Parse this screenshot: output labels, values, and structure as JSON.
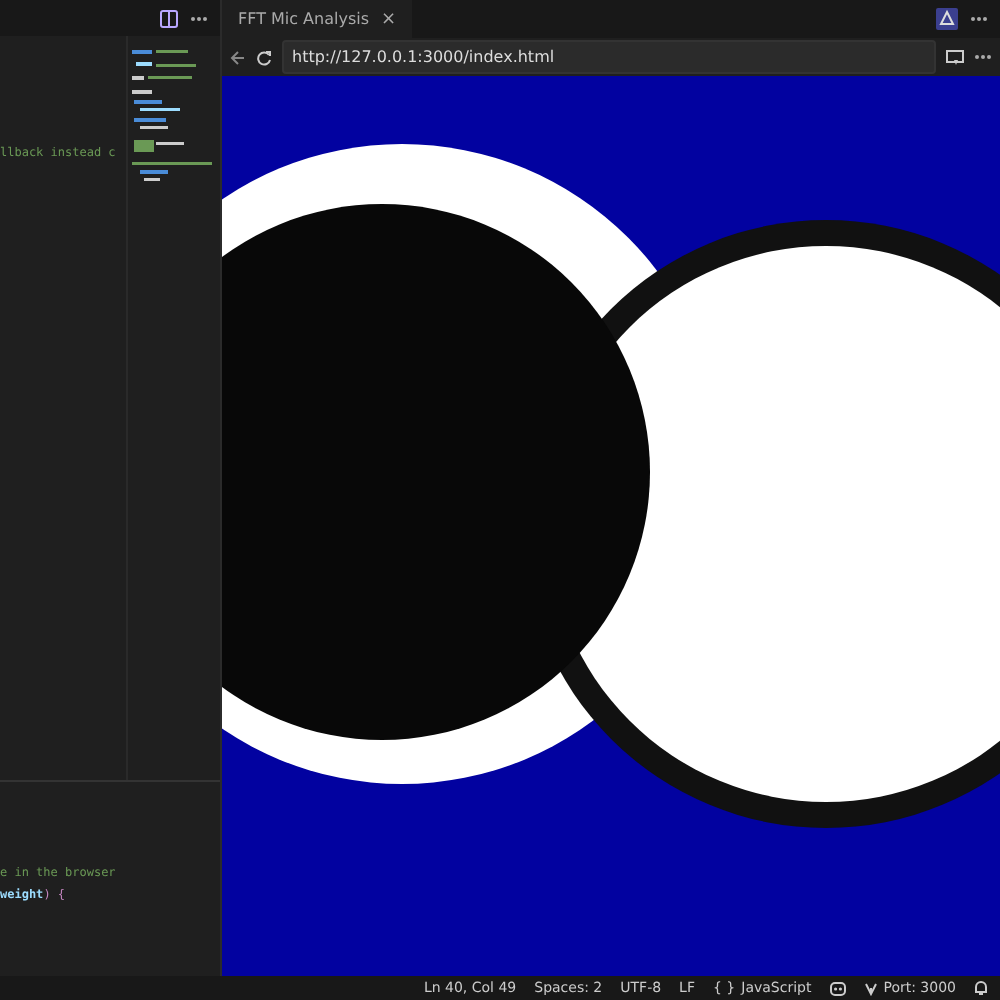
{
  "editor": {
    "top_lines": [
      [
        {
          "kind": "comment",
          "text": "llback instead c"
        }
      ]
    ],
    "bottom_lines": [
      [
        {
          "kind": "comment",
          "text": "e in the browser"
        }
      ],
      [
        {
          "kind": "param",
          "text": "weight"
        },
        {
          "kind": "punct",
          "text": ") {"
        }
      ]
    ]
  },
  "browser": {
    "tab": {
      "title": "FFT Mic Analysis",
      "close": "×"
    },
    "url": "http://127.0.0.1:3000/index.html"
  },
  "status_bar": {
    "items": [
      "Ln 40, Col 49",
      "Spaces: 2",
      "UTF-8",
      "LF"
    ],
    "language_braces": "{ }",
    "language": "JavaScript",
    "port": "Port: 3000"
  }
}
